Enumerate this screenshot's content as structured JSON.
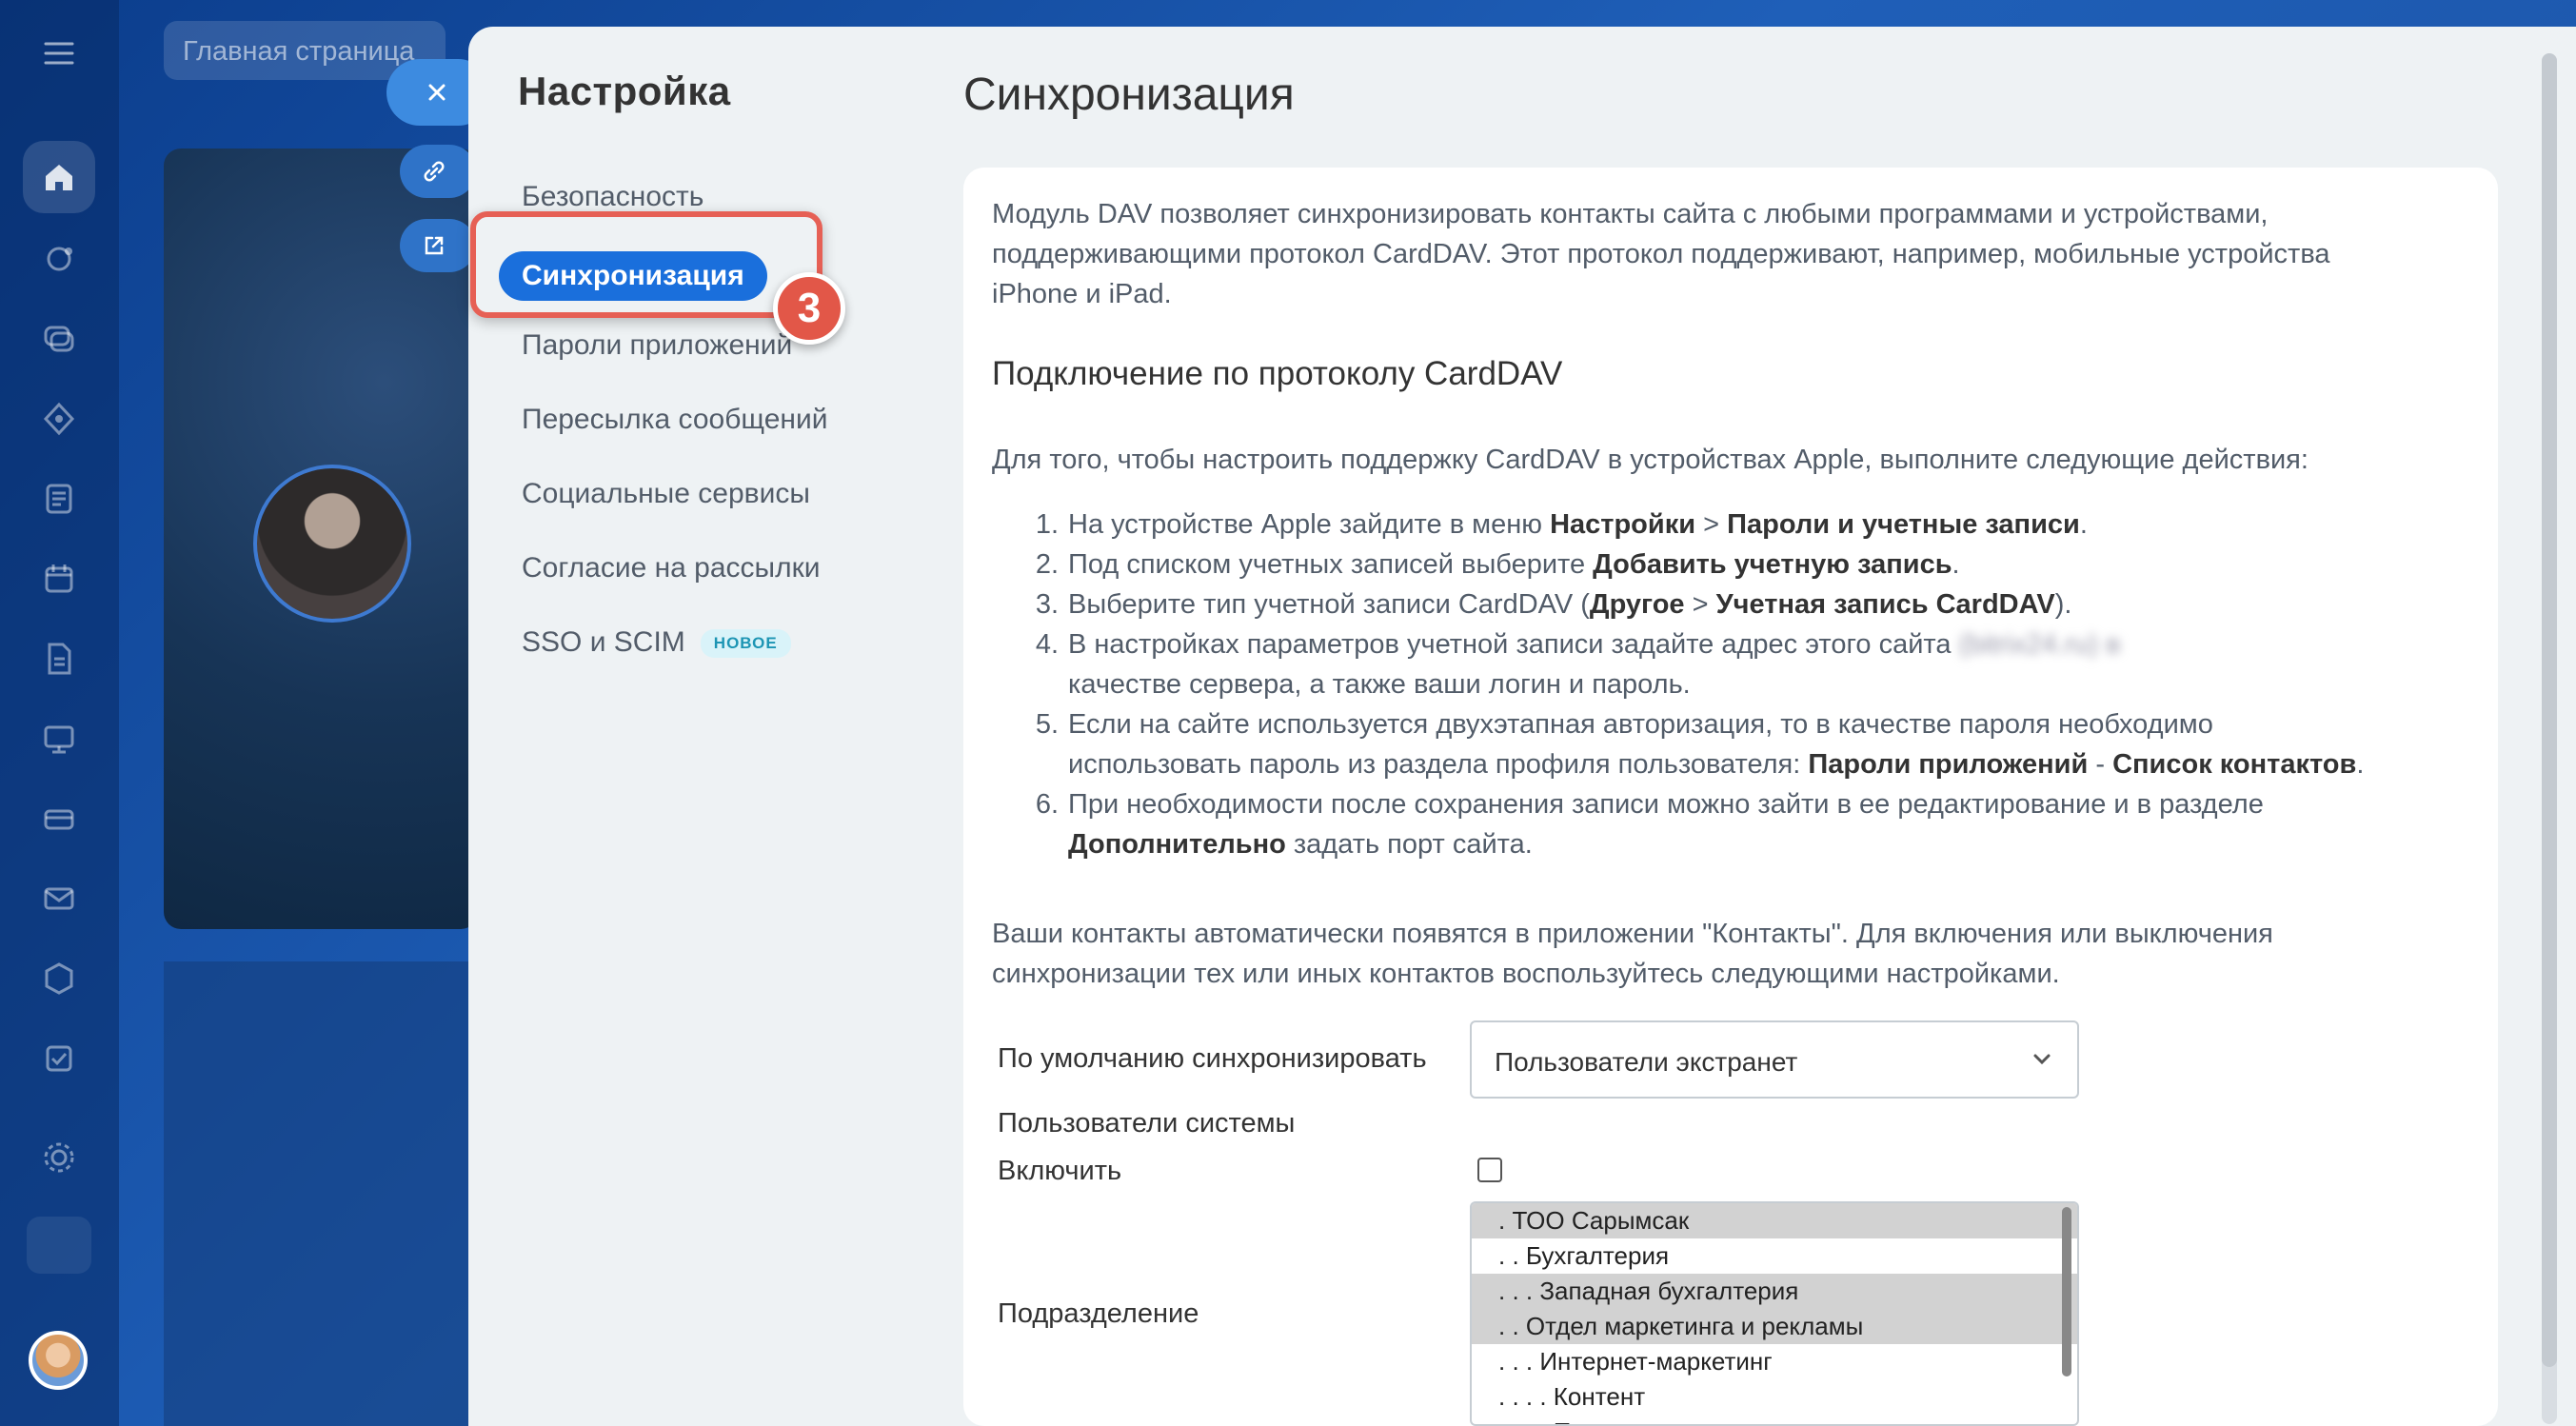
{
  "top_search": {
    "placeholder": "Главная страница"
  },
  "panel": {
    "title": "Настройка",
    "nav": [
      {
        "label": "Безопасность"
      },
      {
        "label": "Синхронизация",
        "active": true
      },
      {
        "label": "Пароли приложений"
      },
      {
        "label": "Пересылка сообщений"
      },
      {
        "label": "Социальные сервисы"
      },
      {
        "label": "Согласие на рассылки"
      },
      {
        "label": "SSO и SCIM",
        "badge": "НОВОЕ"
      }
    ],
    "step_badge": "3"
  },
  "content": {
    "title": "Синхронизация",
    "intro_lines": [
      "Модуль DAV позволяет синхронизировать контакты сайта с любыми программами и устройствами,",
      "поддерживающими протокол CardDAV. Этот протокол поддерживают, например, мобильные устройства",
      "iPhone и iPad."
    ],
    "section_heading": "Подключение по протоколу CardDAV",
    "instructions_intro": "Для того, чтобы настроить поддержку CardDAV в устройствах Apple, выполните следующие действия:",
    "steps": [
      {
        "num": "1.",
        "parts": [
          "На устройстве Apple зайдите в меню ",
          "Настройки",
          " > ",
          "Пароли и учетные записи",
          "."
        ]
      },
      {
        "num": "2.",
        "parts": [
          "Под списком учетных записей выберите ",
          "Добавить учетную запись",
          "."
        ]
      },
      {
        "num": "3.",
        "parts": [
          "Выберите тип учетной записи CardDAV (",
          "Другое",
          " > ",
          "Учетная запись CardDAV",
          ")."
        ]
      },
      {
        "num": "4.",
        "line1_before": "В настройках параметров учетной записи задайте адрес этого сайта ",
        "line1_blurred": "(bitrix24.ru) в",
        "line1_after": "trix24.ru) в",
        "line2": "качестве сервера, а также ваши логин и пароль."
      },
      {
        "num": "5.",
        "line1": "Если на сайте используется двухэтапная авторизация, то в качестве пароля необходимо",
        "line2_before": "использовать пароль из раздела профиля пользователя: ",
        "line2_bold1": "Пароли приложений",
        "line2_mid": " - ",
        "line2_bold2": "Список контактов",
        "line2_end": "."
      },
      {
        "num": "6.",
        "line1": "При необходимости после сохранения записи можно зайти в ее редактирование и в разделе",
        "line2_bold": "Дополнительно",
        "line2_after": " задать порт сайта."
      }
    ],
    "outro_lines": [
      "Ваши контакты автоматически появятся в приложении \"Контакты\". Для включения или выключения",
      "синхронизации тех или иных контактов воспользуйтесь следующими настройками."
    ],
    "form": {
      "default_sync_label": "По умолчанию синхронизировать",
      "default_sync_value": "Пользователи экстранет",
      "system_users_label": "Пользователи системы",
      "enable_label": "Включить",
      "enable_checked": false,
      "department_label": "Подразделение",
      "departments": [
        {
          "label": ". ТОО Сарымсак",
          "selected": true
        },
        {
          "label": ". . Бухгалтерия",
          "selected": false
        },
        {
          "label": ". . . Западная бухгалтерия",
          "selected": true
        },
        {
          "label": ". . Отдел маркетинга и рекламы",
          "selected": true
        },
        {
          "label": ". . . Интернет-маркетинг",
          "selected": false
        },
        {
          "label": ". . . . Контент",
          "selected": false
        },
        {
          "label": ". . . . П",
          "selected": false
        }
      ]
    }
  },
  "colors": {
    "accent": "#1a6fdc",
    "highlight": "#e66055",
    "panel_bg": "#eef2f4"
  }
}
